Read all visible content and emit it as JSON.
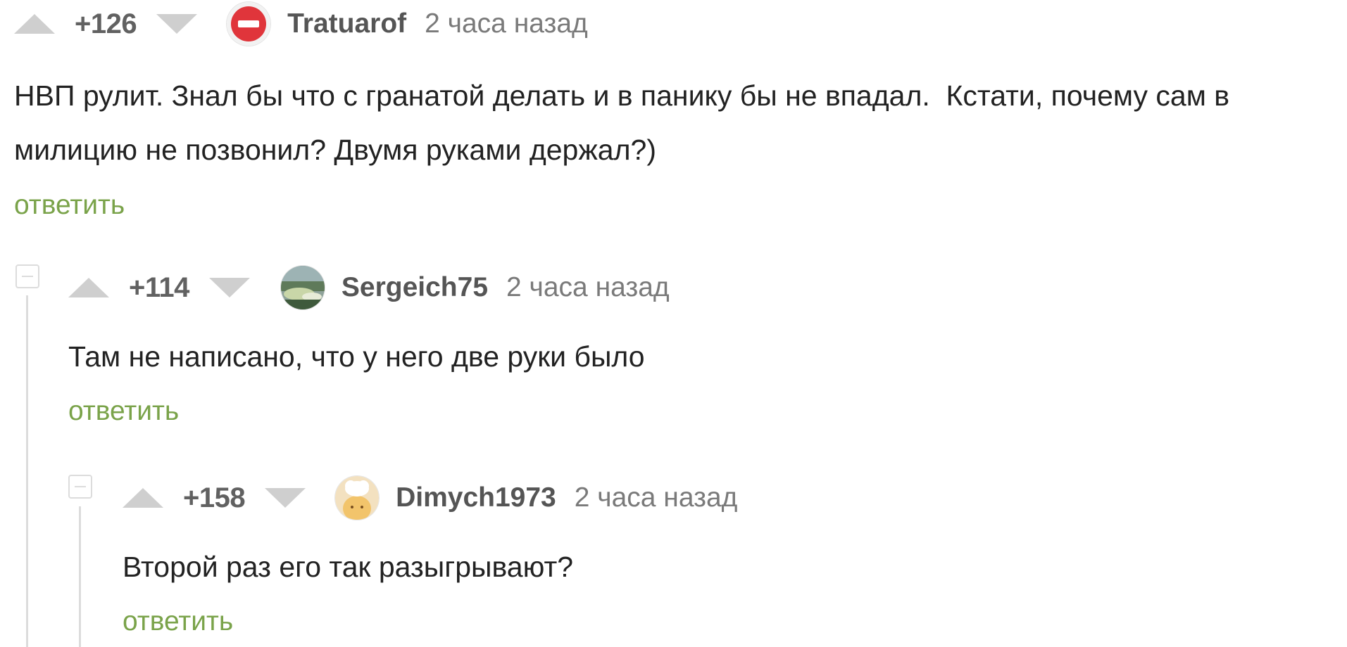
{
  "comments": [
    {
      "rating": "+126",
      "username": "Tratuarof",
      "timestamp": "2 часа назад",
      "avatar_icon": "no-entry-icon",
      "text": "НВП рулит. Знал бы что с гранатой делать и в панику бы не впадал.  Кстати, почему сам в милицию не позвонил? Двумя руками держал?)",
      "reply_label": "ответить"
    },
    {
      "rating": "+114",
      "username": "Sergeich75",
      "timestamp": "2 часа назад",
      "avatar_icon": "landscape-avatar",
      "text": "Там не написано, что у него две руки было",
      "reply_label": "ответить"
    },
    {
      "rating": "+158",
      "username": "Dimych1973",
      "timestamp": "2 часа назад",
      "avatar_icon": "chef-avatar",
      "text": "Второй раз его так разыгрывают?",
      "reply_label": "ответить"
    }
  ],
  "colors": {
    "accent_green": "#7aa34a",
    "vote_arrow": "#cfcfcf",
    "thread_line": "#dcdcdc",
    "no_entry_red": "#e0353b"
  }
}
